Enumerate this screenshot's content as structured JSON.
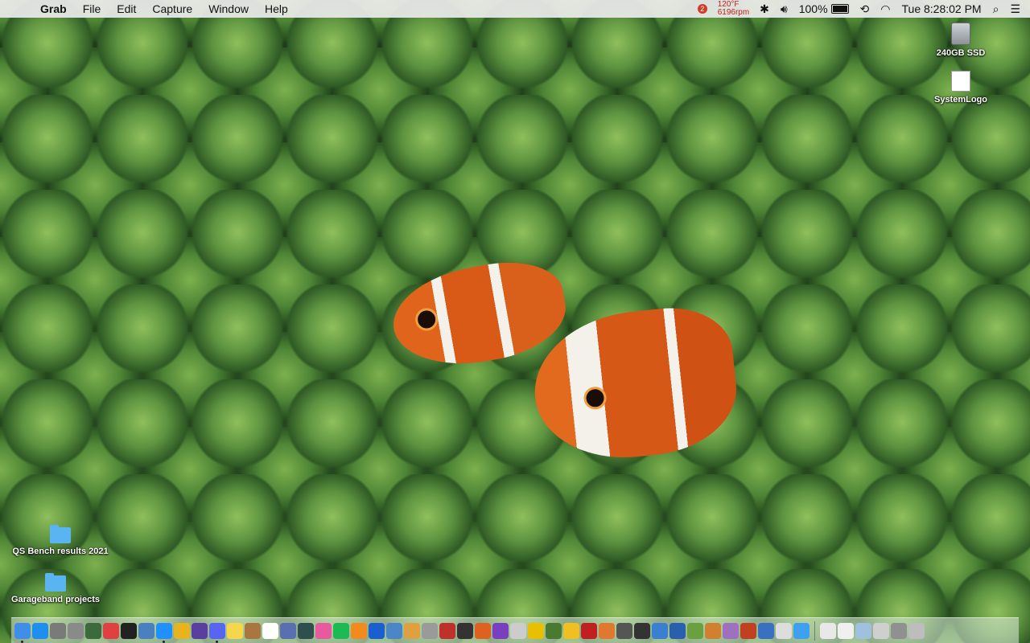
{
  "menubar": {
    "app_name": "Grab",
    "menus": [
      "File",
      "Edit",
      "Capture",
      "Window",
      "Help"
    ],
    "temp": "120°F",
    "fan": "6196rpm",
    "notification_count": "2",
    "battery": "100%",
    "clock": "Tue 8:28:02 PM"
  },
  "desktop": {
    "icons_right": [
      {
        "label": "240GB SSD",
        "icon": "hard-drive-icon"
      },
      {
        "label": "SystemLogo",
        "icon": "apple-logo-icon"
      }
    ],
    "icons_left": [
      {
        "label": "QS Bench results 2021",
        "icon": "folder-icon"
      },
      {
        "label": "Garageband projects",
        "icon": "folder-icon"
      }
    ]
  },
  "dock": {
    "apps": [
      {
        "name": "finder-icon",
        "color": "#3f8fe8",
        "running": true
      },
      {
        "name": "app-store-icon",
        "color": "#1e8ef0",
        "running": false
      },
      {
        "name": "system-preferences-icon",
        "color": "#7a7a7a",
        "running": false
      },
      {
        "name": "photo-booth-icon",
        "color": "#8a8a8a",
        "running": false
      },
      {
        "name": "utility-icon",
        "color": "#3d6a3d",
        "running": false
      },
      {
        "name": "x-app-icon",
        "color": "#e04040",
        "running": false
      },
      {
        "name": "compass-icon",
        "color": "#222222",
        "running": false
      },
      {
        "name": "preview-icon",
        "color": "#4a7fc0",
        "running": false
      },
      {
        "name": "safari-icon",
        "color": "#1e90ff",
        "running": true
      },
      {
        "name": "chrome-icon",
        "color": "#e8b31c",
        "running": false
      },
      {
        "name": "firefox-icon",
        "color": "#5a3fa0",
        "running": false
      },
      {
        "name": "discord-icon",
        "color": "#5865f2",
        "running": true
      },
      {
        "name": "notes-icon",
        "color": "#f6d64a",
        "running": false
      },
      {
        "name": "contacts-icon",
        "color": "#a8763e",
        "running": false
      },
      {
        "name": "calendar-icon",
        "color": "#ffffff",
        "running": false
      },
      {
        "name": "photos-browser-icon",
        "color": "#5a6fb0",
        "running": false
      },
      {
        "name": "time-machine-icon",
        "color": "#2f4f4f",
        "running": false
      },
      {
        "name": "itunes-icon",
        "color": "#e85aa0",
        "running": false
      },
      {
        "name": "spotify-icon",
        "color": "#1db954",
        "running": false
      },
      {
        "name": "books-icon",
        "color": "#f28a1e",
        "running": false
      },
      {
        "name": "malwarebytes-icon",
        "color": "#1a5fd0",
        "running": false
      },
      {
        "name": "guitar-icon",
        "color": "#4a86c8",
        "running": false
      },
      {
        "name": "color-picker-icon",
        "color": "#e0a040",
        "running": false
      },
      {
        "name": "image-app-icon",
        "color": "#9a9a9a",
        "running": false
      },
      {
        "name": "game-icon",
        "color": "#c0302a",
        "running": false
      },
      {
        "name": "skull-icon",
        "color": "#333333",
        "running": false
      },
      {
        "name": "triangle-app-icon",
        "color": "#e06020",
        "running": false
      },
      {
        "name": "epic-icon",
        "color": "#7a3fc0",
        "running": false
      },
      {
        "name": "document-icon",
        "color": "#cccccc",
        "running": false
      },
      {
        "name": "radiation-icon",
        "color": "#e8c000",
        "running": false
      },
      {
        "name": "alien-icon",
        "color": "#4a7a30",
        "running": false
      },
      {
        "name": "smiley-icon",
        "color": "#f0c020",
        "running": false
      },
      {
        "name": "gear-red-icon",
        "color": "#c02020",
        "running": false
      },
      {
        "name": "plane-icon",
        "color": "#e07830",
        "running": false
      },
      {
        "name": "disc-icon",
        "color": "#555555",
        "running": false
      },
      {
        "name": "unity-icon",
        "color": "#333333",
        "running": false
      },
      {
        "name": "vs-code-icon",
        "color": "#3a7fd0",
        "running": false
      },
      {
        "name": "sliders-icon",
        "color": "#2a5fb0",
        "running": false
      },
      {
        "name": "plane-green-icon",
        "color": "#6aa040",
        "running": false
      },
      {
        "name": "blaster-icon",
        "color": "#d08030",
        "running": false
      },
      {
        "name": "cow-icon",
        "color": "#a070c0",
        "running": false
      },
      {
        "name": "chart-app-icon",
        "color": "#c04020",
        "running": false
      },
      {
        "name": "paint-icon",
        "color": "#3a70c0",
        "running": false
      },
      {
        "name": "text-edit-icon",
        "color": "#dddddd",
        "running": false
      },
      {
        "name": "messages-icon",
        "color": "#40a0f0",
        "running": false
      }
    ],
    "docs": [
      {
        "name": "document-stack-icon",
        "color": "#e8e8e8"
      },
      {
        "name": "file-icon",
        "color": "#f0f0f0"
      },
      {
        "name": "screenshot-stack-icon",
        "color": "#a0c0e0"
      },
      {
        "name": "drive-stack-icon",
        "color": "#cfcfcf"
      },
      {
        "name": "window-stack-icon",
        "color": "#909090"
      },
      {
        "name": "trash-icon",
        "color": "#bdbdbd"
      }
    ]
  }
}
